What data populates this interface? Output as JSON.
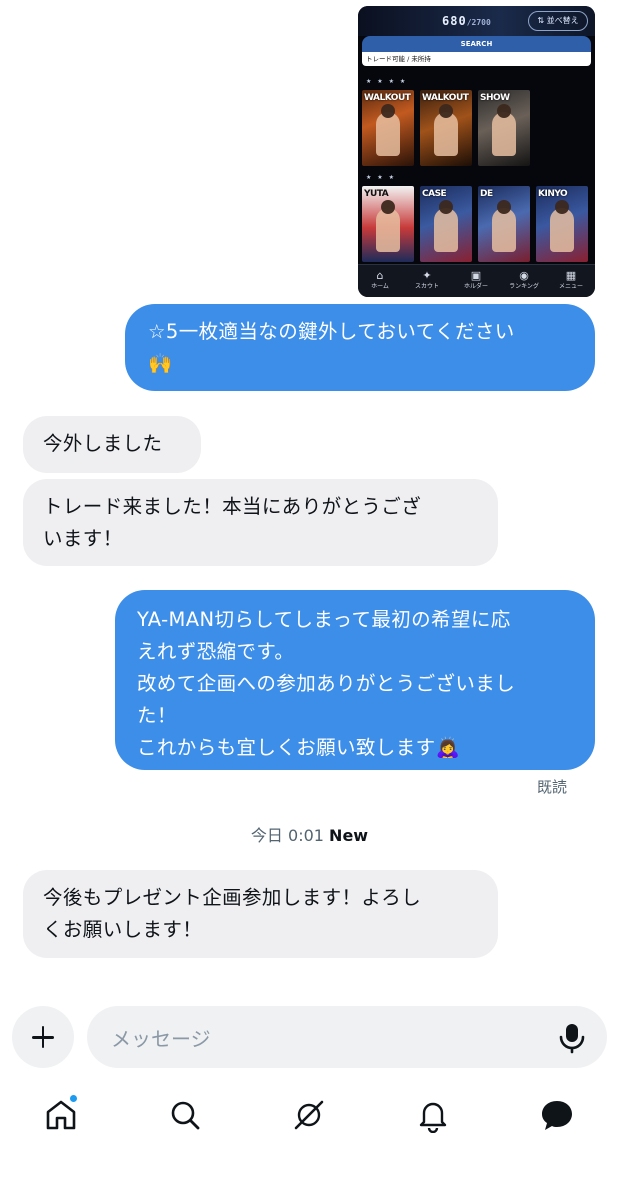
{
  "attachment": {
    "count": "680",
    "count_max": "/2700",
    "sort_label": "⇅ 並べ替え",
    "search_label": "SEARCH",
    "filter_label": "トレード可能 / 未所持",
    "tier4_stars": "★ ★ ★ ★",
    "tier3_stars": "★ ★ ★",
    "card_texts": [
      "WALKOUT",
      "WALKOUT",
      "SHOW",
      "YUTA",
      "CASE",
      "DE",
      "KINYO"
    ],
    "nav": [
      {
        "icon": "home-icon",
        "label": "ホーム"
      },
      {
        "icon": "scout-icon",
        "label": "スカウト"
      },
      {
        "icon": "holder-icon",
        "label": "ホルダー"
      },
      {
        "icon": "ranking-icon",
        "label": "ランキング"
      },
      {
        "icon": "menu-icon",
        "label": "メニュー"
      }
    ]
  },
  "messages": [
    {
      "side": "out",
      "lines": [
        "☆5一枚適当なの鍵外しておいてください",
        "🙌"
      ]
    },
    {
      "side": "in",
      "lines": [
        "今外しました"
      ]
    },
    {
      "side": "in",
      "lines": [
        "トレード来ました！本当にありがとうござ",
        "います！"
      ]
    },
    {
      "side": "out",
      "lines": [
        "YA-MAN切らしてしまって最初の希望に応",
        "えれず恐縮です。",
        "改めて企画への参加ありがとうございまし",
        "た！",
        "これからも宜しくお願い致します🙇‍♀️"
      ]
    },
    {
      "side": "in",
      "lines": [
        "今後もプレゼント企画参加します！よろし",
        "くお願いします！"
      ]
    }
  ],
  "read_receipt": "既読",
  "day_stamp": {
    "day": "今日",
    "time": "0:01",
    "new_label": "New"
  },
  "composer": {
    "placeholder": "メッセージ"
  },
  "tabs": [
    "home-icon",
    "search-icon",
    "grok-icon",
    "notifications-icon",
    "messages-icon"
  ],
  "colors": {
    "outgoing": "#3d8ee8",
    "incoming": "#efeff2",
    "unread_dot": "#1d9bf0"
  }
}
